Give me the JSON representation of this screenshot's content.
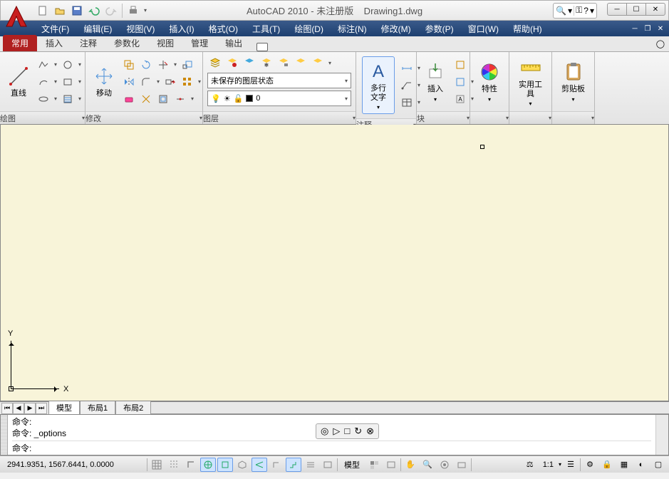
{
  "title": {
    "app": "AutoCAD 2010 - 未注册版",
    "doc": "Drawing1.dwg"
  },
  "menus": [
    "文件(F)",
    "编辑(E)",
    "视图(V)",
    "插入(I)",
    "格式(O)",
    "工具(T)",
    "绘图(D)",
    "标注(N)",
    "修改(M)",
    "参数(P)",
    "窗口(W)",
    "帮助(H)"
  ],
  "tabs": [
    "常用",
    "插入",
    "注释",
    "参数化",
    "视图",
    "管理",
    "输出"
  ],
  "active_tab": 0,
  "ribbon": {
    "draw": {
      "label": "绘图",
      "line": "直线"
    },
    "modify": {
      "label": "修改",
      "move": "移动"
    },
    "layers": {
      "label": "图层",
      "state": "未保存的图层状态",
      "current": "0"
    },
    "annot": {
      "label": "注释",
      "mtext": "多行\n文字"
    },
    "block": {
      "label": "块",
      "insert": "插入"
    },
    "props": {
      "label": "特性"
    },
    "util": {
      "label": "实用工具"
    },
    "clip": {
      "label": "剪贴板"
    }
  },
  "ucs": {
    "x": "X",
    "y": "Y"
  },
  "layout_tabs": [
    "模型",
    "布局1",
    "布局2"
  ],
  "active_layout": 0,
  "cmd": {
    "l1": "命令:",
    "l2": "命令: _options",
    "l3": "命令:"
  },
  "status": {
    "coords": "2941.9351, 1567.6441, 0.0000",
    "modelspace": "模型",
    "scale": "1:1"
  }
}
